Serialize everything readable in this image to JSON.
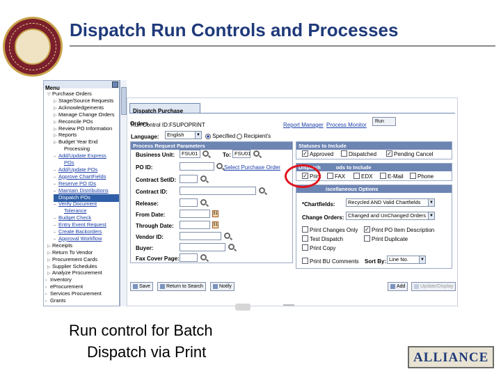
{
  "slide": {
    "title": "Dispatch Run Controls and Processes",
    "caption_line1": "Run control for Batch",
    "caption_line2": "Dispatch via Print"
  },
  "colors": {
    "title": "#1f3a7a",
    "accent_header": "#6d85b3",
    "highlight_circle": "#e0141e",
    "menu_selected": "#2f5fa8"
  },
  "menu": {
    "title": "Menu",
    "items": [
      {
        "label": "Purchase Orders",
        "type": "folder-open"
      },
      {
        "label": "Stage/Source Requests",
        "type": "folder"
      },
      {
        "label": "Acknowledgements",
        "type": "folder"
      },
      {
        "label": "Manage Change Orders",
        "type": "folder"
      },
      {
        "label": "Reconcile POs",
        "type": "folder"
      },
      {
        "label": "Review PO Information",
        "type": "folder"
      },
      {
        "label": "Reports",
        "type": "folder"
      },
      {
        "label": "Budget Year End",
        "type": "folder"
      },
      {
        "label": "Processing",
        "type": "cont"
      },
      {
        "label": "Add/Update Express",
        "type": "link"
      },
      {
        "label": "POs",
        "type": "link-cont"
      },
      {
        "label": "Add/Update POs",
        "type": "link"
      },
      {
        "label": "Approve ChartFields",
        "type": "link"
      },
      {
        "label": "Reserve PO IDs",
        "type": "link"
      },
      {
        "label": "Maintain Distributions",
        "type": "link"
      },
      {
        "label": "Dispatch POs",
        "type": "selected"
      },
      {
        "label": "Verify Document",
        "type": "link"
      },
      {
        "label": "Tolerance",
        "type": "link-cont"
      },
      {
        "label": "Budget Check",
        "type": "link"
      },
      {
        "label": "Entry Event Request",
        "type": "link"
      },
      {
        "label": "Create Backorders",
        "type": "link"
      },
      {
        "label": "Approval Workflow",
        "type": "link"
      },
      {
        "label": "Receipts",
        "type": "folder0"
      },
      {
        "label": "Return To Vendor",
        "type": "folder0"
      },
      {
        "label": "Procurement Cards",
        "type": "folder0"
      },
      {
        "label": "Supplier Schedules",
        "type": "folder0"
      },
      {
        "label": "Analyze Procurement",
        "type": "folder0"
      },
      {
        "label": "Inventory",
        "type": "top"
      },
      {
        "label": "eProcurement",
        "type": "top"
      },
      {
        "label": "Services Procurement",
        "type": "top"
      },
      {
        "label": "Grants",
        "type": "top"
      }
    ]
  },
  "page": {
    "tab": "Dispatch Purchase Orders",
    "run_control_label": "Run Control ID:",
    "run_control_value": "FSUPOPRINT",
    "report_manager": "Report Manager",
    "process_monitor": "Process Monitor",
    "run_button": "Run",
    "language_label": "Language:",
    "language_value": "English",
    "specified": "Specified",
    "recipients": "Recipient's",
    "prp": {
      "header": "Process Request Parameters",
      "business_unit_label": "Business Unit:",
      "business_unit_value": "FSU01",
      "to_label": "To:",
      "to_value": "FSU01",
      "po_id_label": "PO ID:",
      "select_po": "Select Purchase Order",
      "contract_setid_label": "Contract SetID:",
      "contract_id_label": "Contract ID:",
      "release_label": "Release:",
      "from_date_label": "From Date:",
      "through_date_label": "Through Date:",
      "vendor_id_label": "Vendor ID:",
      "buyer_label": "Buyer:",
      "fax_cover_label": "Fax Cover Page:"
    },
    "statuses": {
      "header": "Statuses to Include",
      "approved": "Approved",
      "dispatched": "Dispatched",
      "pending_cancel": "Pending Cancel"
    },
    "dispatch_methods": {
      "header_left": "Dispatch",
      "header_right": "ods to Include",
      "print": "Print",
      "fax": "FAX",
      "edx": "EDX",
      "email": "E-Mail",
      "phone": "Phone"
    },
    "misc": {
      "header_right": "iscellaneous Options",
      "chartfields_label": "*Chartfields:",
      "chartfields_value": "Recycled AND Valid Chartfields",
      "change_orders_label": "Change Orders:",
      "change_orders_value": "Changed and UnChanged Orders",
      "print_changes_only": "Print Changes Only",
      "print_po_item_desc": "Print PO Item Description",
      "test_dispatch": "Test Dispatch",
      "print_duplicate": "Print Duplicate",
      "print_copy": "Print Copy",
      "print_bu_comments": "Print BU Comments",
      "sort_by_label": "Sort By:",
      "sort_by_value": "Line No."
    },
    "toolbar": {
      "save": "Save",
      "return_to_search": "Return to Search",
      "notify": "Notify",
      "add": "Add",
      "update_display": "Update/Display"
    }
  },
  "logo": {
    "text": "ALLIANCE"
  }
}
